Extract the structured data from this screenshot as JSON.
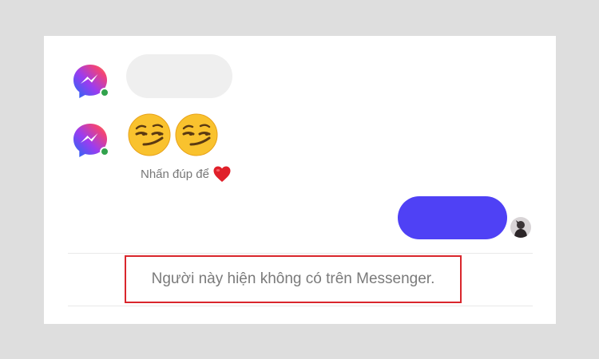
{
  "thread": {
    "contact_avatar_icon": "messenger-logo-icon",
    "incoming_messages": [
      {
        "type": "text-bubble",
        "text": ""
      },
      {
        "type": "emoji",
        "emojis": [
          "smirking-face",
          "smirking-face"
        ]
      }
    ],
    "double_tap_hint": "Nhấn đúp để",
    "hint_icon": "heart-icon",
    "outgoing_message": {
      "type": "text-bubble",
      "text": ""
    },
    "self_avatar": "user-avatar"
  },
  "notice": {
    "text": "Người này hiện không có trên Messenger."
  },
  "colors": {
    "outgoing_bubble": "#4f41f5",
    "incoming_bubble": "#efefef",
    "highlight_border": "#d9262c",
    "online_dot": "#31a24c"
  }
}
